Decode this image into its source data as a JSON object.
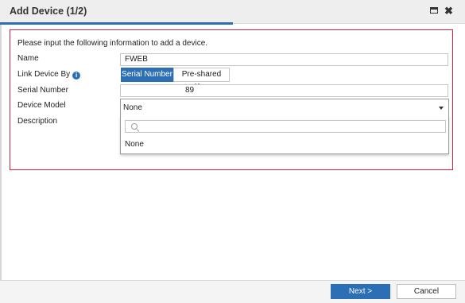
{
  "dialog": {
    "title": "Add Device (1/2)",
    "icons": {
      "maximize": "maximize-icon",
      "close": "close-icon",
      "close_glyph": "✖"
    }
  },
  "colors": {
    "accent": "#2d6fb5",
    "frame_border": "#d61f3a"
  },
  "form": {
    "intro": "Please input the following information to add a device.",
    "name": {
      "label": "Name",
      "value": "FWEB"
    },
    "link_device_by": {
      "label": "Link Device By",
      "info_glyph": "i",
      "options": [
        "Serial Number",
        "Pre-shared Key"
      ],
      "selected": "Serial Number"
    },
    "serial_number": {
      "label": "Serial Number",
      "value": "89"
    },
    "device_model": {
      "label": "Device Model",
      "selected": "None",
      "search_placeholder": "",
      "options": [
        "None"
      ]
    },
    "description": {
      "label": "Description"
    }
  },
  "footer": {
    "next_label": "Next >",
    "cancel_label": "Cancel"
  }
}
